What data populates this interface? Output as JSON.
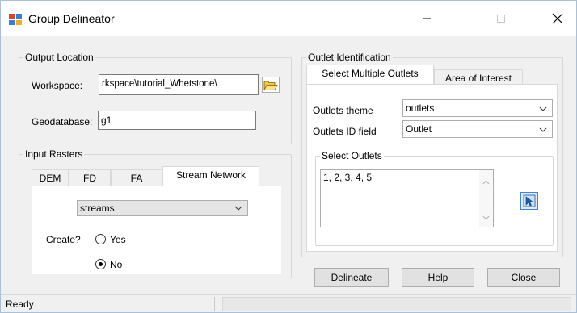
{
  "window": {
    "title": "Group Delineator"
  },
  "output_location": {
    "legend": "Output Location",
    "workspace_label": "Workspace:",
    "workspace_value": "rkspace\\tutorial_Whetstone\\",
    "geodatabase_label": "Geodatabase:",
    "geodatabase_value": "g1"
  },
  "input_rasters": {
    "legend": "Input Rasters",
    "tabs": [
      "DEM",
      "FD",
      "FA",
      "Stream Network"
    ],
    "selected_raster": "streams",
    "create_label": "Create?",
    "yes_label": "Yes",
    "no_label": "No",
    "selected_option": "No"
  },
  "outlet_identification": {
    "legend": "Outlet Identification",
    "tabs": [
      "Select Multiple Outlets",
      "Area of Interest"
    ],
    "outlets_theme_label": "Outlets theme",
    "outlets_theme_value": "outlets",
    "outlets_id_label": "Outlets ID field",
    "outlets_id_value": "Outlet",
    "select_outlets_legend": "Select Outlets",
    "select_outlets_value": "1, 2, 3, 4, 5"
  },
  "buttons": {
    "delineate": "Delineate",
    "help": "Help",
    "close": "Close"
  },
  "status": {
    "text": "Ready"
  }
}
